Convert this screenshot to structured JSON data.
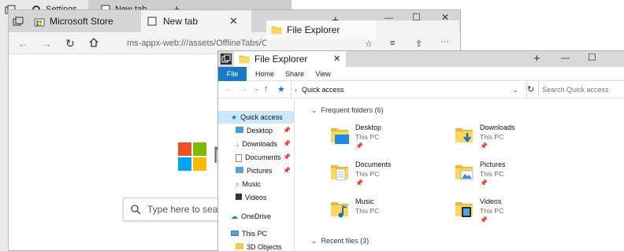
{
  "back_browser": {
    "tabs": [
      {
        "label": "Settings"
      },
      {
        "label": "New tab"
      }
    ],
    "new_tab_label": "+"
  },
  "mid_browser": {
    "tabs": [
      {
        "label": "Microsoft Store"
      },
      {
        "label": "New tab"
      }
    ],
    "new_tab_label": "+",
    "address": "ms-appx-web:///assets/OfflineTabs/OfflineTabs.html",
    "brand_letter": "M",
    "search_placeholder": "Type here to search",
    "logo_colors": [
      "#f25022",
      "#7fba00",
      "#00a4ef",
      "#ffb900"
    ]
  },
  "floating_tab": {
    "label": "File Explorer"
  },
  "file_explorer": {
    "tab_label": "File Explorer",
    "new_tab_label": "+",
    "ribbon": [
      "File",
      "Home",
      "Share",
      "View"
    ],
    "breadcrumb": "Quick access",
    "search_placeholder": "Search Quick access",
    "accent": "#1979ca",
    "nav": [
      {
        "label": "Quick access",
        "icon": "star-icon",
        "pinned": false
      },
      {
        "label": "Desktop",
        "icon": "folder-icon",
        "pinned": true
      },
      {
        "label": "Downloads",
        "icon": "download-folder-icon",
        "pinned": true
      },
      {
        "label": "Documents",
        "icon": "documents-folder-icon",
        "pinned": true
      },
      {
        "label": "Pictures",
        "icon": "pictures-folder-icon",
        "pinned": true
      },
      {
        "label": "Music",
        "icon": "music-folder-icon",
        "pinned": false
      },
      {
        "label": "Videos",
        "icon": "videos-folder-icon",
        "pinned": false
      },
      {
        "label": "OneDrive",
        "icon": "cloud-icon",
        "pinned": false
      },
      {
        "label": "This PC",
        "icon": "computer-icon",
        "pinned": false
      },
      {
        "label": "3D Objects",
        "icon": "folder-icon",
        "pinned": false
      }
    ],
    "frequent_header": "Frequent folders (6)",
    "recent_header": "Recent files (3)",
    "folders": [
      {
        "name": "Desktop",
        "location": "This PC",
        "pinned": true
      },
      {
        "name": "Downloads",
        "location": "This PC",
        "pinned": true
      },
      {
        "name": "Documents",
        "location": "This PC",
        "pinned": true
      },
      {
        "name": "Pictures",
        "location": "This PC",
        "pinned": true
      },
      {
        "name": "Music",
        "location": "This PC",
        "pinned": false
      },
      {
        "name": "Videos",
        "location": "This PC",
        "pinned": true
      }
    ]
  }
}
